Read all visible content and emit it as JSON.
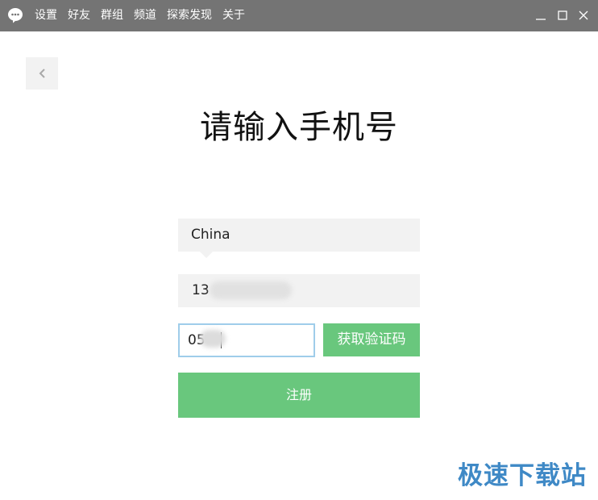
{
  "titlebar": {
    "menu": [
      "设置",
      "好友",
      "群组",
      "频道",
      "探索发现",
      "关于"
    ]
  },
  "heading": "请输入手机号",
  "country": {
    "value": "China"
  },
  "phone": {
    "value": "13"
  },
  "code": {
    "value": "05"
  },
  "buttons": {
    "get_code": "获取验证码",
    "register": "注册"
  },
  "watermark": "极速下载站",
  "colors": {
    "titlebar": "#747474",
    "accent_green": "#69c77d",
    "field_background": "#f2f2f2",
    "focus_border": "#9fcdea",
    "watermark": "#3f89c6"
  },
  "icons": {
    "app_logo": "chat-bubble-icon",
    "back": "chevron-left-icon",
    "minimize": "minimize-icon",
    "maximize": "maximize-icon",
    "close": "close-icon"
  }
}
